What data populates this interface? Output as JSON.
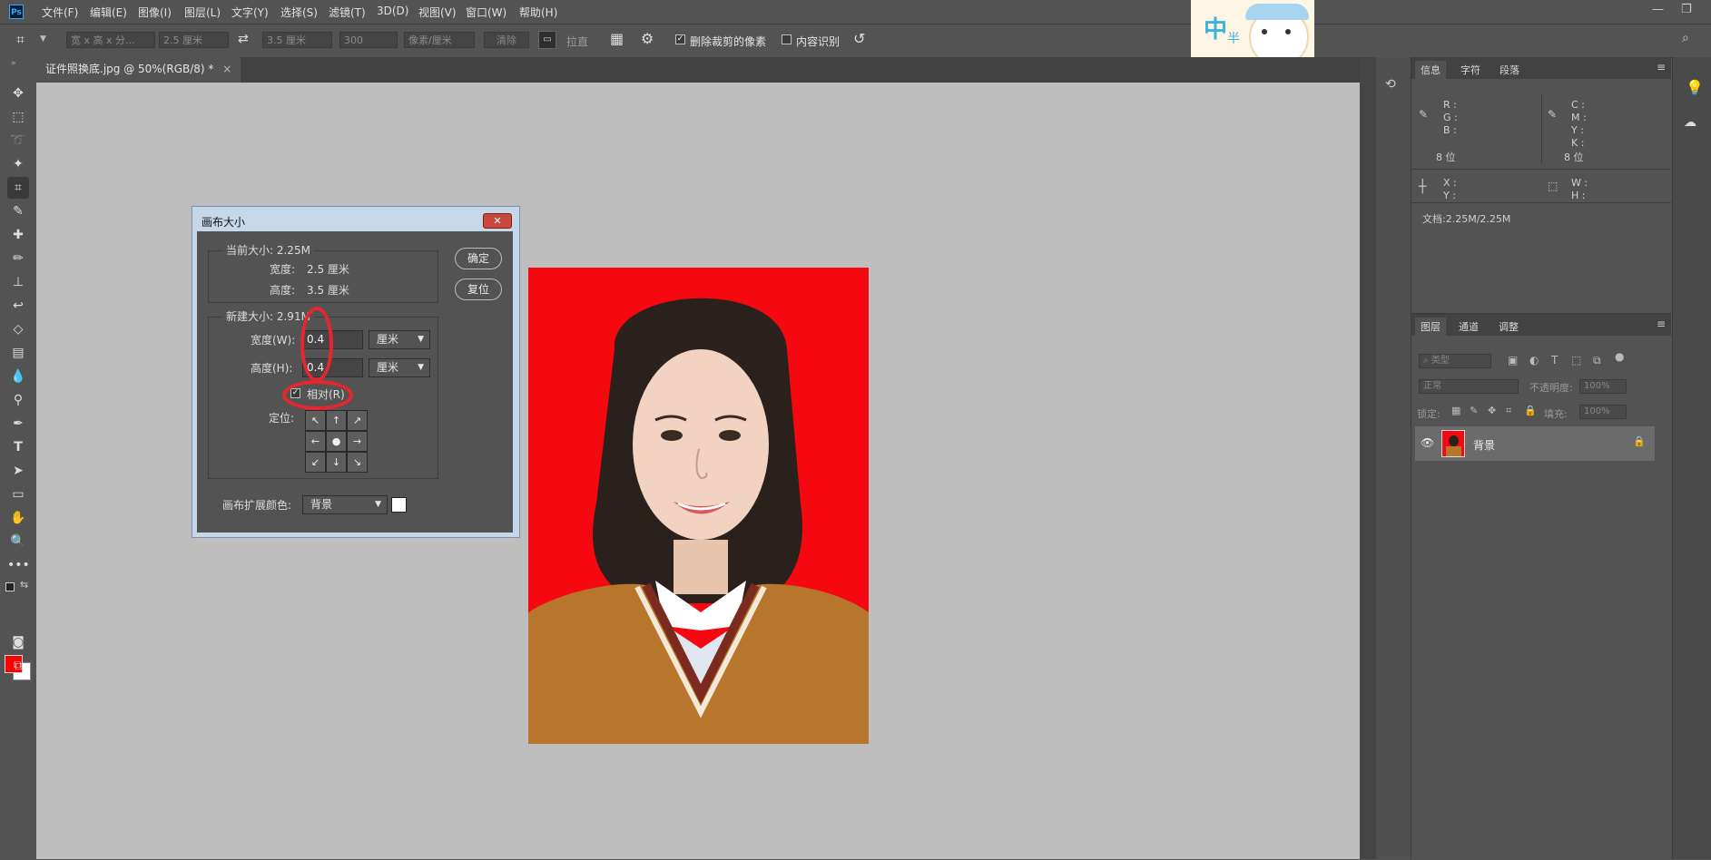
{
  "app": {
    "logo": "Ps"
  },
  "menu": [
    "文件(F)",
    "编辑(E)",
    "图像(I)",
    "图层(L)",
    "文字(Y)",
    "选择(S)",
    "滤镜(T)",
    "3D(D)",
    "视图(V)",
    "窗口(W)",
    "帮助(H)"
  ],
  "window_controls": {
    "minimize": "—",
    "restore": "❐"
  },
  "options_bar": {
    "ratio_label": "宽 x 高 x 分...",
    "width_value": "2.5 厘米",
    "height_value": "3.5 厘米",
    "resolution_value": "300",
    "unit_label": "像素/厘米",
    "clear_label": "清除",
    "straighten_label": "拉直",
    "delete_cropped_label": "删除裁剪的像素",
    "delete_cropped_checked": true,
    "content_aware_label": "内容识别",
    "content_aware_checked": false
  },
  "sticker": {
    "text1": "中",
    "text2": "半"
  },
  "document_tab": {
    "title": "证件照换底.jpg @ 50%(RGB/8) *",
    "close": "×"
  },
  "dialog": {
    "title": "画布大小",
    "close": "✕",
    "current_size_label": "当前大小: 2.25M",
    "current_width_label": "宽度:",
    "current_width_value": "2.5 厘米",
    "current_height_label": "高度:",
    "current_height_value": "3.5 厘米",
    "new_size_label": "新建大小: 2.91M",
    "width_label": "宽度(W):",
    "width_value": "0.4",
    "width_unit": "厘米",
    "height_label": "高度(H):",
    "height_value": "0.4",
    "height_unit": "厘米",
    "relative_label": "相对(R)",
    "relative_checked": true,
    "anchor_label": "定位:",
    "anchor_arrows": [
      "↖",
      "↑",
      "↗",
      "←",
      "●",
      "→",
      "↙",
      "↓",
      "↘"
    ],
    "ok_label": "确定",
    "reset_label": "复位",
    "ext_color_label": "画布扩展颜色:",
    "ext_color_value": "背景",
    "ext_color_swatch": "#ffffff"
  },
  "info_panel": {
    "tabs": [
      "信息",
      "字符",
      "段落"
    ],
    "rgb": [
      "R :",
      "G :",
      "B :"
    ],
    "cmyk": [
      "C :",
      "M :",
      "Y :",
      "K :"
    ],
    "bit_left": "8 位",
    "bit_right": "8 位",
    "xy": [
      "X :",
      "Y :"
    ],
    "wh": [
      "W :",
      "H :"
    ],
    "doc_info": "文档:2.25M/2.25M"
  },
  "layers_panel": {
    "tabs": [
      "图层",
      "通道",
      "调整"
    ],
    "filter_label": "类型",
    "blend_mode": "正常",
    "opacity_label": "不透明度:",
    "opacity_value": "100%",
    "lock_label": "锁定:",
    "fill_label": "填充:",
    "fill_value": "100%",
    "layer_name": "背景"
  },
  "colors": {
    "foreground": "#ff0000",
    "background": "#ffffff",
    "photo_bg": "#f60811"
  }
}
